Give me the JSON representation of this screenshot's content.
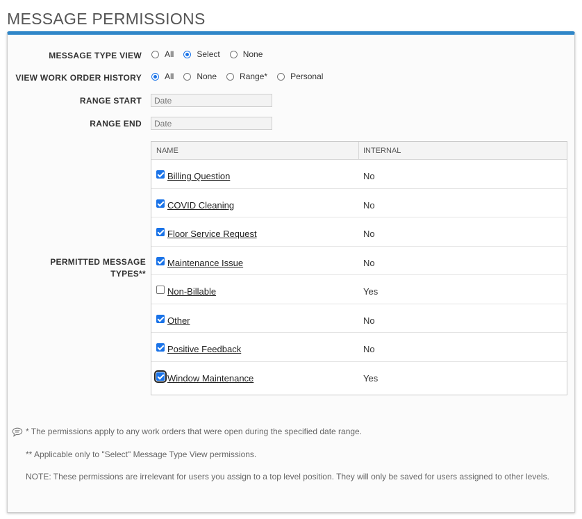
{
  "page": {
    "title": "MESSAGE PERMISSIONS"
  },
  "form": {
    "message_type_view": {
      "label": "MESSAGE TYPE VIEW",
      "options": [
        "All",
        "Select",
        "None"
      ],
      "selected": "Select"
    },
    "view_work_order_history": {
      "label": "VIEW WORK ORDER HISTORY",
      "options": [
        "All",
        "None",
        "Range*",
        "Personal"
      ],
      "selected": "All"
    },
    "range_start": {
      "label": "RANGE START",
      "placeholder": "Date",
      "value": ""
    },
    "range_end": {
      "label": "RANGE END",
      "placeholder": "Date",
      "value": ""
    },
    "permitted_message_types": {
      "label_line1": "PERMITTED MESSAGE",
      "label_line2": "TYPES**",
      "columns": {
        "name": "NAME",
        "internal": "INTERNAL"
      },
      "rows": [
        {
          "name": "Billing Question",
          "internal": "No",
          "checked": true
        },
        {
          "name": "COVID Cleaning",
          "internal": "No",
          "checked": true
        },
        {
          "name": "Floor Service Request",
          "internal": "No",
          "checked": true
        },
        {
          "name": "Maintenance Issue",
          "internal": "No",
          "checked": true
        },
        {
          "name": "Non-Billable",
          "internal": "Yes",
          "checked": false
        },
        {
          "name": "Other",
          "internal": "No",
          "checked": true
        },
        {
          "name": "Positive Feedback",
          "internal": "No",
          "checked": true
        },
        {
          "name": "Window Maintenance",
          "internal": "Yes",
          "checked": true,
          "focused": true
        }
      ]
    }
  },
  "notes": {
    "icon": "comment-icon",
    "note1": "* The permissions apply to any work orders that were open during the specified date range.",
    "note2": "** Applicable only to \"Select\" Message Type View permissions.",
    "note3": "NOTE: These permissions are irrelevant for users you assign to a top level position. They will only be saved for users assigned to other levels."
  },
  "colors": {
    "accent": "#2f86c8",
    "checkbox": "#1a73e8"
  }
}
